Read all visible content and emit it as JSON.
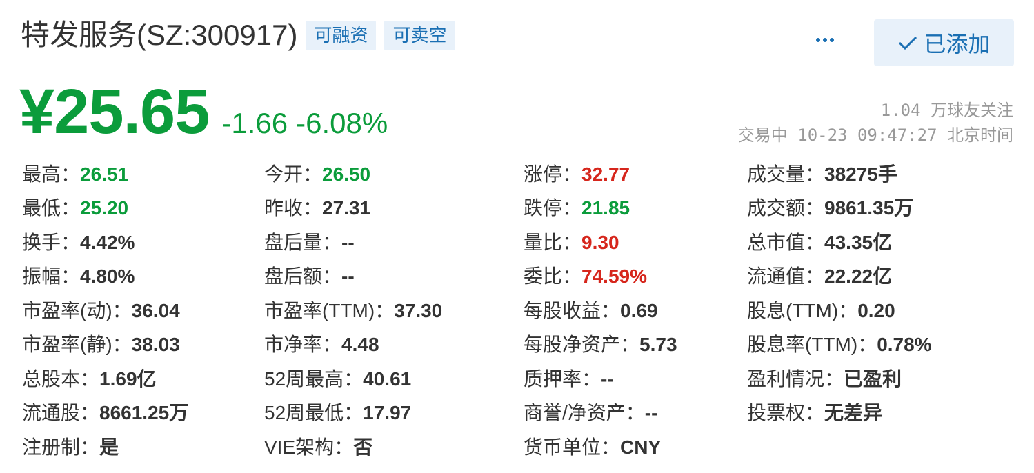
{
  "stock": {
    "title": "特发服务(SZ:300917)",
    "tags": [
      "可融资",
      "可卖空"
    ],
    "more_icon": "more-horizontal-icon",
    "added_label": "已添加",
    "added_icon": "check-icon",
    "price": "¥25.65",
    "change": "-1.66",
    "change_pct": "-6.08%",
    "followers": "1.04 万球友关注",
    "status_time": "交易中 10-23 09:47:27 北京时间",
    "colors": {
      "up": "#d6261c",
      "down": "#0b9c3b",
      "accent": "#1a6fb3"
    }
  },
  "quote": {
    "rows": [
      [
        {
          "label": "最高：",
          "value": "26.51",
          "color": "green"
        },
        {
          "label": "今开：",
          "value": "26.50",
          "color": "green"
        },
        {
          "label": "涨停：",
          "value": "32.77",
          "color": "red"
        },
        {
          "label": "成交量：",
          "value": "38275手",
          "color": ""
        }
      ],
      [
        {
          "label": "最低：",
          "value": "25.20",
          "color": "green"
        },
        {
          "label": "昨收：",
          "value": "27.31",
          "color": ""
        },
        {
          "label": "跌停：",
          "value": "21.85",
          "color": "green"
        },
        {
          "label": "成交额：",
          "value": "9861.35万",
          "color": ""
        }
      ],
      [
        {
          "label": "换手：",
          "value": "4.42%",
          "color": ""
        },
        {
          "label": "盘后量：",
          "value": "--",
          "color": ""
        },
        {
          "label": "量比：",
          "value": "9.30",
          "color": "red"
        },
        {
          "label": "总市值：",
          "value": "43.35亿",
          "color": ""
        }
      ],
      [
        {
          "label": "振幅：",
          "value": "4.80%",
          "color": ""
        },
        {
          "label": "盘后额：",
          "value": "--",
          "color": ""
        },
        {
          "label": "委比：",
          "value": "74.59%",
          "color": "red"
        },
        {
          "label": "流通值：",
          "value": "22.22亿",
          "color": ""
        }
      ],
      [
        {
          "label": "市盈率(动)：",
          "value": "36.04",
          "color": ""
        },
        {
          "label": "市盈率(TTM)：",
          "value": "37.30",
          "color": ""
        },
        {
          "label": "每股收益：",
          "value": "0.69",
          "color": ""
        },
        {
          "label": "股息(TTM)：",
          "value": "0.20",
          "color": ""
        }
      ],
      [
        {
          "label": "市盈率(静)：",
          "value": "38.03",
          "color": ""
        },
        {
          "label": "市净率：",
          "value": "4.48",
          "color": ""
        },
        {
          "label": "每股净资产：",
          "value": "5.73",
          "color": ""
        },
        {
          "label": "股息率(TTM)：",
          "value": "0.78%",
          "color": ""
        }
      ],
      [
        {
          "label": "总股本：",
          "value": "1.69亿",
          "color": ""
        },
        {
          "label": "52周最高：",
          "value": "40.61",
          "color": ""
        },
        {
          "label": "质押率：",
          "value": "--",
          "color": ""
        },
        {
          "label": "盈利情况：",
          "value": "已盈利",
          "color": ""
        }
      ],
      [
        {
          "label": "流通股：",
          "value": "8661.25万",
          "color": ""
        },
        {
          "label": "52周最低：",
          "value": "17.97",
          "color": ""
        },
        {
          "label": "商誉/净资产：",
          "value": "--",
          "color": ""
        },
        {
          "label": "投票权：",
          "value": "无差异",
          "color": ""
        }
      ],
      [
        {
          "label": "注册制：",
          "value": "是",
          "color": ""
        },
        {
          "label": "VIE架构：",
          "value": "否",
          "color": ""
        },
        {
          "label": "货币单位：",
          "value": "CNY",
          "color": ""
        }
      ]
    ]
  }
}
